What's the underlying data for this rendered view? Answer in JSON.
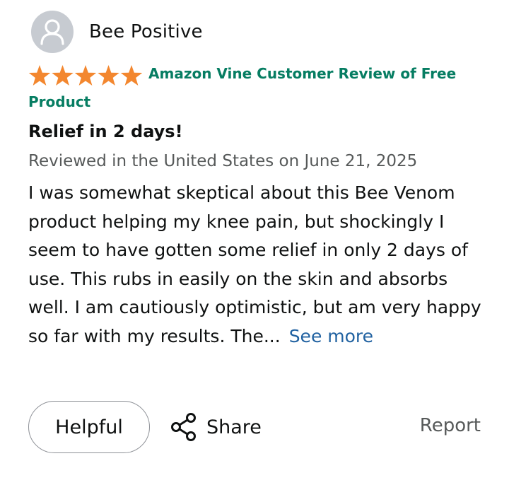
{
  "reviewer": {
    "name": "Bee Positive",
    "avatar_icon": "default-user-icon"
  },
  "rating": {
    "stars": 5,
    "max": 5,
    "star_color": "#f3872f"
  },
  "badge": {
    "text": "Amazon Vine Customer Review of Free Product",
    "color": "#067d62"
  },
  "review": {
    "title": "Relief in 2 days!",
    "meta": "Reviewed in the United States on June 21, 2025",
    "body": "I was somewhat skeptical about this Bee Venom product helping my knee pain, but shockingly I seem to have gotten some relief in only 2 days of use. This rubs in easily on the skin and absorbs well. I am cautiously optimistic, but am very happy so far with my results. The...",
    "see_more": "See more"
  },
  "actions": {
    "helpful": "Helpful",
    "share": "Share",
    "share_icon": "share-icon",
    "report": "Report"
  }
}
